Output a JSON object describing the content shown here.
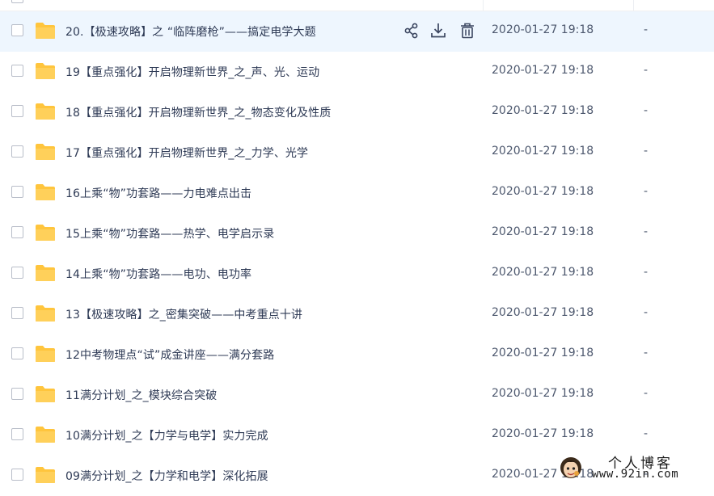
{
  "rows": [
    {
      "name": "20.【极速攻略】之 “临阵磨枪”——搞定电学大题",
      "time": "2020-01-27 19:18",
      "size": "-"
    },
    {
      "name": "19【重点强化】开启物理新世界_之_声、光、运动",
      "time": "2020-01-27 19:18",
      "size": "-"
    },
    {
      "name": "18【重点强化】开启物理新世界_之_物态变化及性质",
      "time": "2020-01-27 19:18",
      "size": "-"
    },
    {
      "name": "17【重点强化】开启物理新世界_之_力学、光学",
      "time": "2020-01-27 19:18",
      "size": "-"
    },
    {
      "name": "16上乘“物”功套路——力电难点出击",
      "time": "2020-01-27 19:18",
      "size": "-"
    },
    {
      "name": "15上乘“物”功套路——热学、电学启示录",
      "time": "2020-01-27 19:18",
      "size": "-"
    },
    {
      "name": "14上乘“物”功套路——电功、电功率",
      "time": "2020-01-27 19:18",
      "size": "-"
    },
    {
      "name": "13【极速攻略】之_密集突破——中考重点十讲",
      "time": "2020-01-27 19:18",
      "size": "-"
    },
    {
      "name": "12中考物理点“试”成金讲座——满分套路",
      "time": "2020-01-27 19:18",
      "size": "-"
    },
    {
      "name": "11满分计划_之_模块综合突破",
      "time": "2020-01-27 19:18",
      "size": "-"
    },
    {
      "name": "10满分计划_之【力学与电学】实力完成",
      "time": "2020-01-27 19:18",
      "size": "-"
    },
    {
      "name": "09满分计划_之【力学和电学】深化拓展",
      "time": "2020-01-27 19:18",
      "size": "-"
    }
  ],
  "row_actions": {
    "icons": [
      "share-icon",
      "download-icon",
      "delete-icon"
    ]
  },
  "watermark": {
    "title": "个人博客",
    "url": "www.92in.com"
  },
  "colors": {
    "hover_row": "#eef6fe",
    "folder": "#ffc53d",
    "text": "#2e3a55"
  }
}
